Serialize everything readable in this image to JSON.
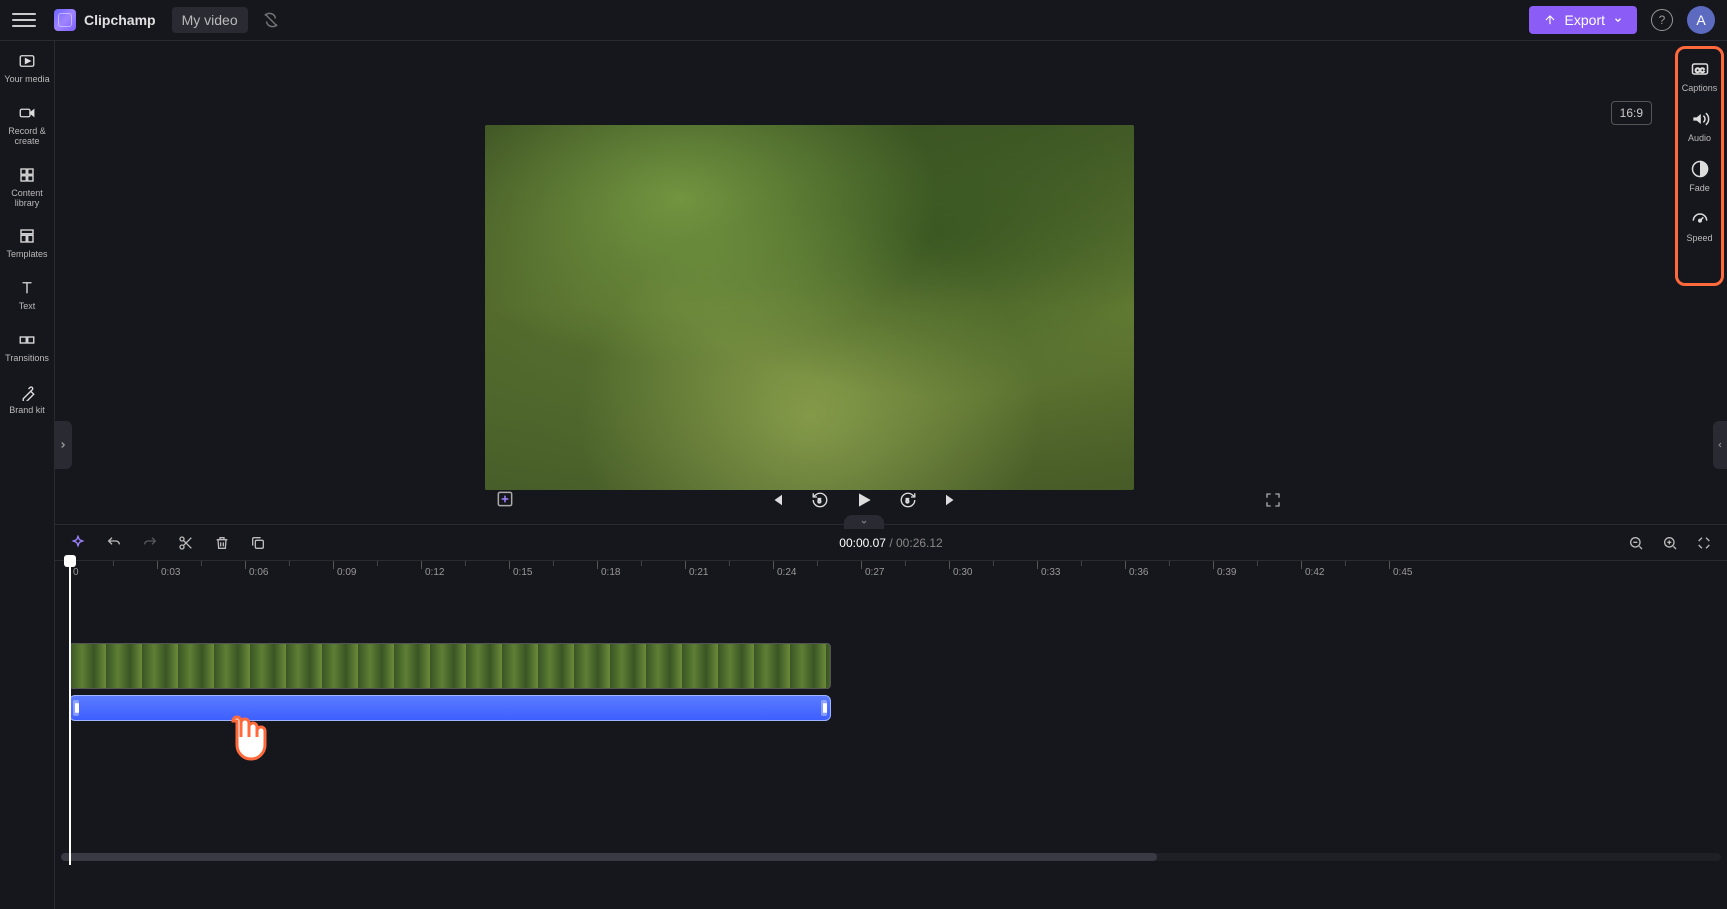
{
  "header": {
    "app_name": "Clipchamp",
    "project_name": "My video",
    "export_label": "Export",
    "avatar_initial": "A"
  },
  "left_sidebar": {
    "items": [
      {
        "label": "Your media",
        "icon": "media-icon"
      },
      {
        "label": "Record & create",
        "icon": "record-icon"
      },
      {
        "label": "Content library",
        "icon": "content-icon"
      },
      {
        "label": "Templates",
        "icon": "templates-icon"
      },
      {
        "label": "Text",
        "icon": "text-icon"
      },
      {
        "label": "Transitions",
        "icon": "transitions-icon"
      },
      {
        "label": "Brand kit",
        "icon": "brandkit-icon"
      }
    ]
  },
  "right_sidebar": {
    "items": [
      {
        "label": "Captions",
        "icon": "captions-icon"
      },
      {
        "label": "Audio",
        "icon": "audio-icon"
      },
      {
        "label": "Fade",
        "icon": "fade-icon"
      },
      {
        "label": "Speed",
        "icon": "speed-icon"
      }
    ]
  },
  "preview": {
    "aspect_label": "16:9"
  },
  "timeline": {
    "current_time": "00:00.07",
    "total_time": "00:26.12",
    "ticks": [
      "0",
      "0:03",
      "0:06",
      "0:09",
      "0:12",
      "0:15",
      "0:18",
      "0:21",
      "0:24",
      "0:27",
      "0:30",
      "0:33",
      "0:36",
      "0:39",
      "0:42",
      "0:45"
    ]
  },
  "colors": {
    "accent": "#8b5cf6",
    "highlight": "#ff6a3d",
    "audio_clip": "#3d5fff"
  }
}
